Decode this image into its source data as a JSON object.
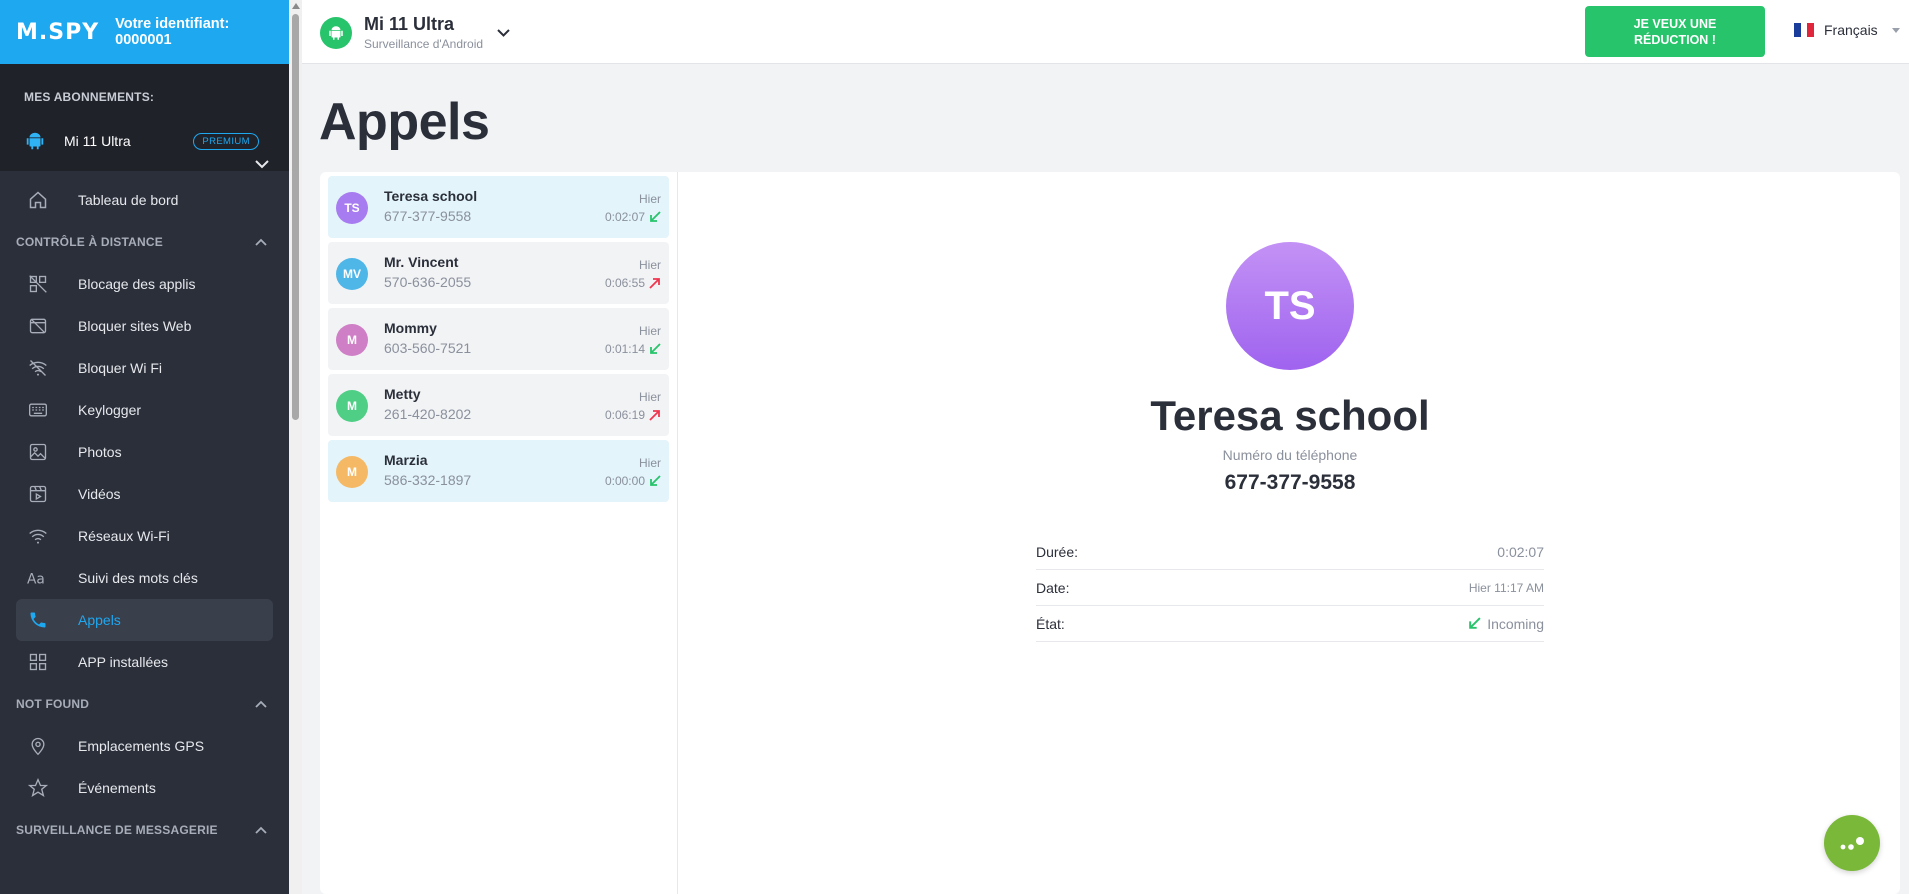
{
  "brand": {
    "logo": "M.SPY",
    "user_id": "Votre identifiant: 0000001"
  },
  "subscriptions": {
    "header": "MES ABONNEMENTS:",
    "device_name": "Mi 11 Ultra",
    "badge": "PREMIUM"
  },
  "nav": {
    "dashboard": "Tableau de bord",
    "section_remote": "CONTRÔLE À DISTANCE",
    "remote_items": [
      {
        "label": "Blocage des applis",
        "icon": "app-block-icon"
      },
      {
        "label": "Bloquer sites Web",
        "icon": "web-block-icon"
      },
      {
        "label": "Bloquer Wi Fi",
        "icon": "wifi-off-icon"
      },
      {
        "label": "Keylogger",
        "icon": "keyboard-icon"
      },
      {
        "label": "Photos",
        "icon": "image-icon"
      },
      {
        "label": "Vidéos",
        "icon": "video-icon"
      },
      {
        "label": "Réseaux Wi-Fi",
        "icon": "wifi-icon"
      },
      {
        "label": "Suivi des mots clés",
        "icon": "text-icon"
      },
      {
        "label": "Appels",
        "icon": "phone-icon",
        "active": true
      },
      {
        "label": "APP installées",
        "icon": "apps-grid-icon"
      }
    ],
    "section_notfound": "NOT FOUND",
    "notfound_items": [
      {
        "label": "Emplacements GPS",
        "icon": "location-pin-icon"
      },
      {
        "label": "Événements",
        "icon": "star-icon"
      }
    ],
    "section_messaging": "SURVEILLANCE DE MESSAGERIE"
  },
  "topbar": {
    "device_title": "Mi 11 Ultra",
    "device_subtitle": "Surveillance d'Android",
    "promo_button": "JE VEUX UNE RÉDUCTION !",
    "language": "Français"
  },
  "page": {
    "title": "Appels"
  },
  "calls": [
    {
      "initials": "TS",
      "name": "Teresa school",
      "number": "677-377-9558",
      "day": "Hier",
      "duration": "0:02:07",
      "direction": "incoming",
      "color": "#a77cf0",
      "highlighted": true
    },
    {
      "initials": "MV",
      "name": "Mr. Vincent",
      "number": "570-636-2055",
      "day": "Hier",
      "duration": "0:06:55",
      "direction": "outgoing",
      "color": "#4fb6e8",
      "highlighted": false
    },
    {
      "initials": "M",
      "name": "Mommy",
      "number": "603-560-7521",
      "day": "Hier",
      "duration": "0:01:14",
      "direction": "incoming",
      "color": "#cf7fc6",
      "highlighted": false
    },
    {
      "initials": "M",
      "name": "Metty",
      "number": "261-420-8202",
      "day": "Hier",
      "duration": "0:06:19",
      "direction": "outgoing",
      "color": "#4fcf86",
      "highlighted": false
    },
    {
      "initials": "M",
      "name": "Marzia",
      "number": "586-332-1897",
      "day": "Hier",
      "duration": "0:00:00",
      "direction": "incoming",
      "color": "#f5b965",
      "highlighted": true
    }
  ],
  "detail": {
    "initials": "TS",
    "name": "Teresa school",
    "phone_label": "Numéro du téléphone",
    "phone": "677-377-9558",
    "rows": [
      {
        "key": "Durée:",
        "value": "0:02:07"
      },
      {
        "key": "Date:",
        "value": "Hier 11:17 AM"
      },
      {
        "key": "État:",
        "value": "Incoming"
      }
    ]
  },
  "colors": {
    "accent": "#1ea8f0",
    "green": "#27c46b",
    "incoming": "#27c46b",
    "outgoing": "#f0364f",
    "sidebar": "#2b2f3a",
    "fab": "#7ab83a"
  }
}
